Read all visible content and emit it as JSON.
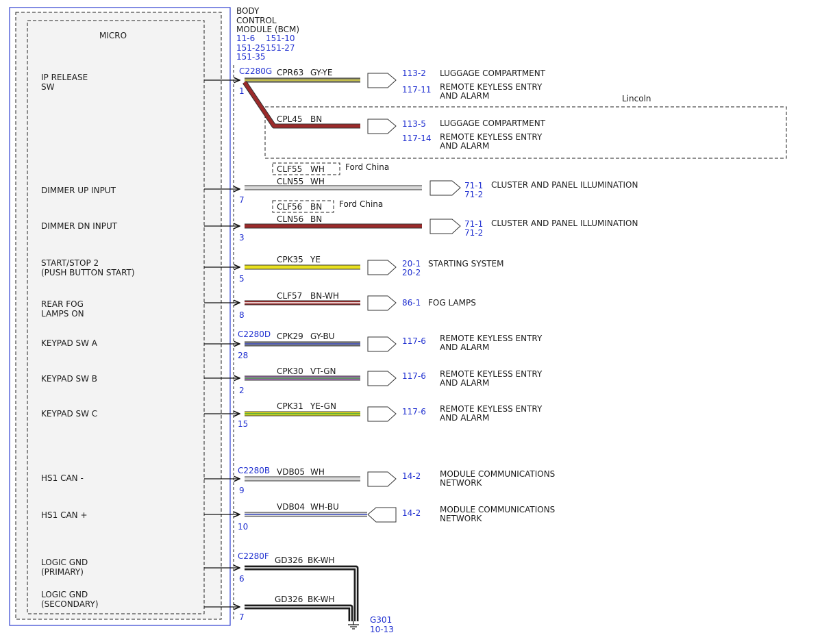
{
  "module": {
    "title_lines": [
      "BODY",
      "CONTROL",
      "MODULE (BCM)"
    ],
    "refs": [
      [
        "11-6",
        "151-10"
      ],
      [
        "151-25",
        "151-27"
      ],
      [
        "151-35",
        ""
      ]
    ],
    "inner_label": "MICRO"
  },
  "inputs": [
    {
      "lines": [
        "IP RELEASE",
        "SW"
      ]
    },
    {
      "lines": [
        "DIMMER UP INPUT"
      ]
    },
    {
      "lines": [
        "DIMMER DN INPUT"
      ]
    },
    {
      "lines": [
        "START/STOP 2",
        "(PUSH BUTTON START)"
      ]
    },
    {
      "lines": [
        "REAR FOG",
        "LAMPS ON"
      ]
    },
    {
      "lines": [
        "KEYPAD SW A"
      ]
    },
    {
      "lines": [
        "KEYPAD SW B"
      ]
    },
    {
      "lines": [
        "KEYPAD SW C"
      ]
    },
    {
      "lines": [
        "HS1 CAN -"
      ]
    },
    {
      "lines": [
        "HS1 CAN +"
      ]
    },
    {
      "lines": [
        "LOGIC GND",
        "(PRIMARY)"
      ]
    },
    {
      "lines": [
        "LOGIC GND",
        "(SECONDARY)"
      ]
    }
  ],
  "connectors": [
    "C2280G",
    "C2280D",
    "C2280B",
    "C2280F"
  ],
  "pins": [
    "1",
    "7",
    "3",
    "5",
    "8",
    "28",
    "2",
    "15",
    "9",
    "10",
    "6",
    "7"
  ],
  "circuits": [
    {
      "id": "CPR63",
      "color": "GY-YE",
      "base": "#8a8a6a",
      "stripe": "#d8d040",
      "refs": [
        "113-2",
        "117-11"
      ],
      "dest": [
        "LUGGAGE COMPARTMENT",
        "REMOTE KEYLESS ENTRY",
        "AND ALARM"
      ]
    },
    {
      "id": "CPL45",
      "color": "BN",
      "base": "#9b2a2a",
      "stripe": "",
      "refs": [
        "113-5",
        "117-14"
      ],
      "dest": [
        "LUGGAGE COMPARTMENT",
        "REMOTE KEYLESS ENTRY",
        "AND ALARM"
      ]
    },
    {
      "id": "CLN55",
      "color": "WH",
      "base": "#d8d8d8",
      "stripe": "",
      "refs": [
        "71-1",
        "71-2"
      ],
      "dest": [
        "CLUSTER AND PANEL ILLUMINATION"
      ]
    },
    {
      "id": "CLN56",
      "color": "BN",
      "base": "#9b2a2a",
      "stripe": "",
      "refs": [
        "71-1",
        "71-2"
      ],
      "dest": [
        "CLUSTER AND PANEL ILLUMINATION"
      ]
    },
    {
      "id": "CPK35",
      "color": "YE",
      "base": "#e8e020",
      "stripe": "",
      "refs": [
        "20-1",
        "20-2"
      ],
      "dest": [
        "STARTING SYSTEM"
      ]
    },
    {
      "id": "CLF57",
      "color": "BN-WH",
      "base": "#9b2a2a",
      "stripe": "#ffffff",
      "refs": [
        "86-1"
      ],
      "dest": [
        "FOG LAMPS"
      ]
    },
    {
      "id": "CPK29",
      "color": "GY-BU",
      "base": "#888888",
      "stripe": "#3a4ac0",
      "refs": [
        "117-6"
      ],
      "dest": [
        "REMOTE KEYLESS ENTRY",
        "AND ALARM"
      ]
    },
    {
      "id": "CPK30",
      "color": "VT-GN",
      "base": "#b070c0",
      "stripe": "#40a040",
      "refs": [
        "117-6"
      ],
      "dest": [
        "REMOTE KEYLESS ENTRY",
        "AND ALARM"
      ]
    },
    {
      "id": "CPK31",
      "color": "YE-GN",
      "base": "#e8e020",
      "stripe": "#40a040",
      "refs": [
        "117-6"
      ],
      "dest": [
        "REMOTE KEYLESS ENTRY",
        "AND ALARM"
      ]
    },
    {
      "id": "VDB05",
      "color": "WH",
      "base": "#d8d8d8",
      "stripe": "",
      "refs": [
        "14-2"
      ],
      "dest": [
        "MODULE COMMUNICATIONS",
        "NETWORK"
      ]
    },
    {
      "id": "VDB04",
      "color": "WH-BU",
      "base": "#d8d8d8",
      "stripe": "#3a4ac0",
      "refs": [
        "14-2"
      ],
      "dest": [
        "MODULE COMMUNICATIONS",
        "NETWORK"
      ]
    },
    {
      "id": "GD326",
      "color": "BK-WH",
      "base": "#111111",
      "stripe": "#ffffff",
      "refs": [],
      "dest": []
    },
    {
      "id": "GD326",
      "color": "BK-WH",
      "base": "#111111",
      "stripe": "#ffffff",
      "refs": [],
      "dest": []
    }
  ],
  "alternates": [
    {
      "id": "CLF55",
      "color": "WH",
      "note": "Ford China"
    },
    {
      "id": "CLF56",
      "color": "BN",
      "note": "Ford China"
    }
  ],
  "variant_note": "Lincoln",
  "ground": {
    "id": "G301",
    "ref": "10-13"
  }
}
